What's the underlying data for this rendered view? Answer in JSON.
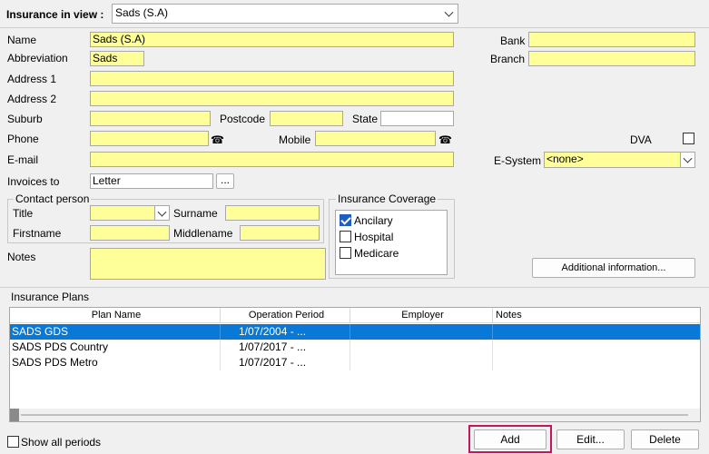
{
  "header": {
    "insurance_label": "Insurance in view :",
    "insurance_selected": "Sads (S.A)"
  },
  "form": {
    "name_label": "Name",
    "name_value": "Sads (S.A)",
    "abbrev_label": "Abbreviation",
    "abbrev_value": "Sads",
    "address1_label": "Address 1",
    "address1_value": "",
    "address2_label": "Address 2",
    "address2_value": "",
    "suburb_label": "Suburb",
    "suburb_value": "",
    "postcode_label": "Postcode",
    "postcode_value": "",
    "state_label": "State",
    "state_value": "",
    "phone_label": "Phone",
    "phone_value": "",
    "mobile_label": "Mobile",
    "mobile_value": "",
    "email_label": "E-mail",
    "email_value": "",
    "invoices_label": "Invoices to",
    "invoices_value": "Letter",
    "browse_label": "...",
    "bank_label": "Bank",
    "bank_value": "",
    "branch_label": "Branch",
    "branch_value": "",
    "dva_label": "DVA",
    "esystem_label": "E-System",
    "esystem_value": "<none>",
    "notes_label": "Notes",
    "notes_value": "",
    "additional_info_label": "Additional information..."
  },
  "contact": {
    "title": "Contact person",
    "title_label": "Title",
    "title_value": "",
    "surname_label": "Surname",
    "surname_value": "",
    "firstname_label": "Firstname",
    "firstname_value": "",
    "middlename_label": "Middlename",
    "middlename_value": ""
  },
  "coverage": {
    "title": "Insurance Coverage",
    "items": [
      {
        "label": "Ancilary",
        "checked": true
      },
      {
        "label": "Hospital",
        "checked": false
      },
      {
        "label": "Medicare",
        "checked": false
      }
    ]
  },
  "plans": {
    "title": "Insurance Plans",
    "columns": [
      "Plan Name",
      "Operation Period",
      "Employer",
      "Notes"
    ],
    "rows": [
      {
        "plan": "SADS GDS",
        "period": "1/07/2004 - ...",
        "employer": "",
        "notes": ""
      },
      {
        "plan": "SADS PDS Country",
        "period": "1/07/2017 - ...",
        "employer": "",
        "notes": ""
      },
      {
        "plan": "SADS PDS Metro",
        "period": "1/07/2017 - ...",
        "employer": "",
        "notes": ""
      }
    ]
  },
  "footer": {
    "show_all_label": "Show all periods",
    "add_label": "Add",
    "edit_label": "Edit...",
    "delete_label": "Delete"
  },
  "icons": {
    "phone": "phone-icon",
    "mobile": "phone-icon"
  },
  "colors": {
    "field_yellow": "#ffff99",
    "selection_blue": "#0a78d7",
    "highlight_red": "#c2185b"
  }
}
